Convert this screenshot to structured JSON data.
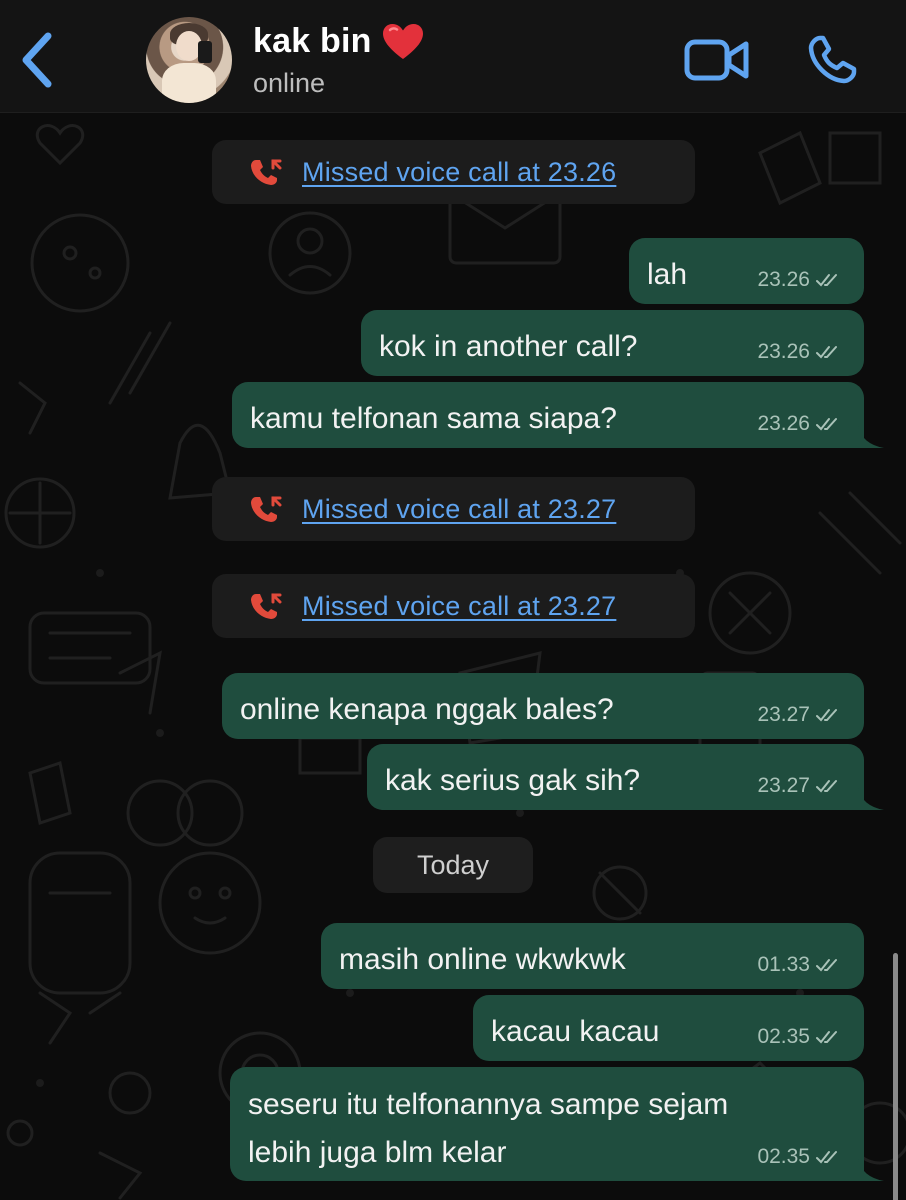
{
  "header": {
    "back_icon": "chevron-left-icon",
    "contact_name": "kak bin",
    "contact_emoji": "red-heart-icon",
    "status": "online",
    "video_icon": "video-camera-icon",
    "call_icon": "phone-icon"
  },
  "events": {
    "missed_1": "Missed voice call at 23.26",
    "missed_2": "Missed voice call at 23.27",
    "missed_3": "Missed voice call at 23.27",
    "date_divider": "Today"
  },
  "messages": [
    {
      "text": "lah",
      "time": "23.26"
    },
    {
      "text": "kok in another call?",
      "time": "23.26"
    },
    {
      "text": "kamu telfonan sama siapa?",
      "time": "23.26"
    },
    {
      "text": "online kenapa nggak bales?",
      "time": "23.27"
    },
    {
      "text": "kak serius gak sih?",
      "time": "23.27"
    },
    {
      "text": "masih online wkwkwk",
      "time": "01.33"
    },
    {
      "text": "kacau kacau",
      "time": "02.35"
    },
    {
      "text_line1": "seseru itu telfonannya sampe sejam",
      "text_line2": "lebih juga blm kelar",
      "time": "02.35"
    }
  ],
  "colors": {
    "accent_blue": "#5fa4f0",
    "outgoing_bubble": "#1f4d3e",
    "missed_red": "#e24a3b"
  }
}
